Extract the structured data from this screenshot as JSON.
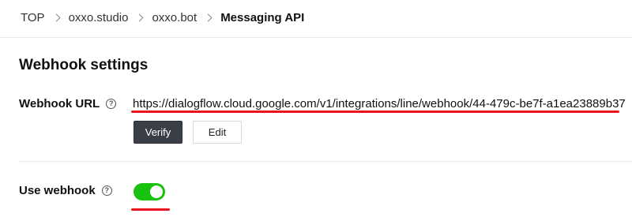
{
  "breadcrumb": [
    "TOP",
    "oxxo.studio",
    "oxxo.bot",
    "Messaging API"
  ],
  "section": {
    "title": "Webhook settings"
  },
  "webhook": {
    "label": "Webhook URL",
    "help_glyph": "?",
    "url": "https://dialogflow.cloud.google.com/v1/integrations/line/webhook/44-479c-be7f-a1ea23889b37",
    "verify_label": "Verify",
    "edit_label": "Edit"
  },
  "use_webhook": {
    "label": "Use webhook",
    "help_glyph": "?",
    "enabled": true
  },
  "colors": {
    "toggle_on": "#19c20f",
    "annotation_underline": "#e8141e",
    "primary_button": "#3a3f47"
  }
}
